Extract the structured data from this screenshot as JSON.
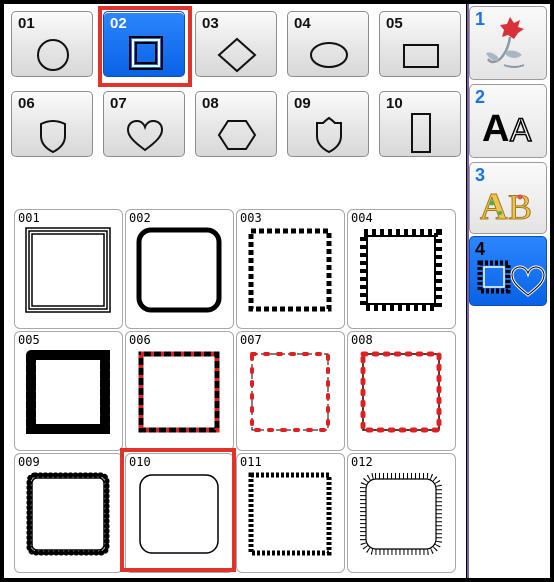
{
  "shape_buttons": [
    {
      "num": "01",
      "shape": "circle-icon"
    },
    {
      "num": "02",
      "shape": "square-icon",
      "selected": true
    },
    {
      "num": "03",
      "shape": "diamond-icon"
    },
    {
      "num": "04",
      "shape": "ellipse-icon"
    },
    {
      "num": "05",
      "shape": "rectangle-icon"
    },
    {
      "num": "06",
      "shape": "shield-icon"
    },
    {
      "num": "07",
      "shape": "heart-icon"
    },
    {
      "num": "08",
      "shape": "hexagon-icon"
    },
    {
      "num": "09",
      "shape": "badge-icon"
    },
    {
      "num": "10",
      "shape": "tall-rectangle-icon"
    }
  ],
  "categories": [
    {
      "num": "1",
      "icon": "flower-icon"
    },
    {
      "num": "2",
      "icon": "font-aa-icon",
      "label": "AA"
    },
    {
      "num": "3",
      "icon": "decorative-ab-icon",
      "label": "AB"
    },
    {
      "num": "4",
      "icon": "frame-heart-icon",
      "active": true
    }
  ],
  "frames": [
    {
      "num": "001"
    },
    {
      "num": "002"
    },
    {
      "num": "003"
    },
    {
      "num": "004"
    },
    {
      "num": "005"
    },
    {
      "num": "006"
    },
    {
      "num": "007"
    },
    {
      "num": "008"
    },
    {
      "num": "009"
    },
    {
      "num": "010",
      "selected": true
    },
    {
      "num": "011"
    },
    {
      "num": "012"
    }
  ],
  "colors": {
    "accent": "#1670f0",
    "highlight": "#e0332a",
    "tab_number": "#1a73e8",
    "red_dot": "#e02020"
  }
}
